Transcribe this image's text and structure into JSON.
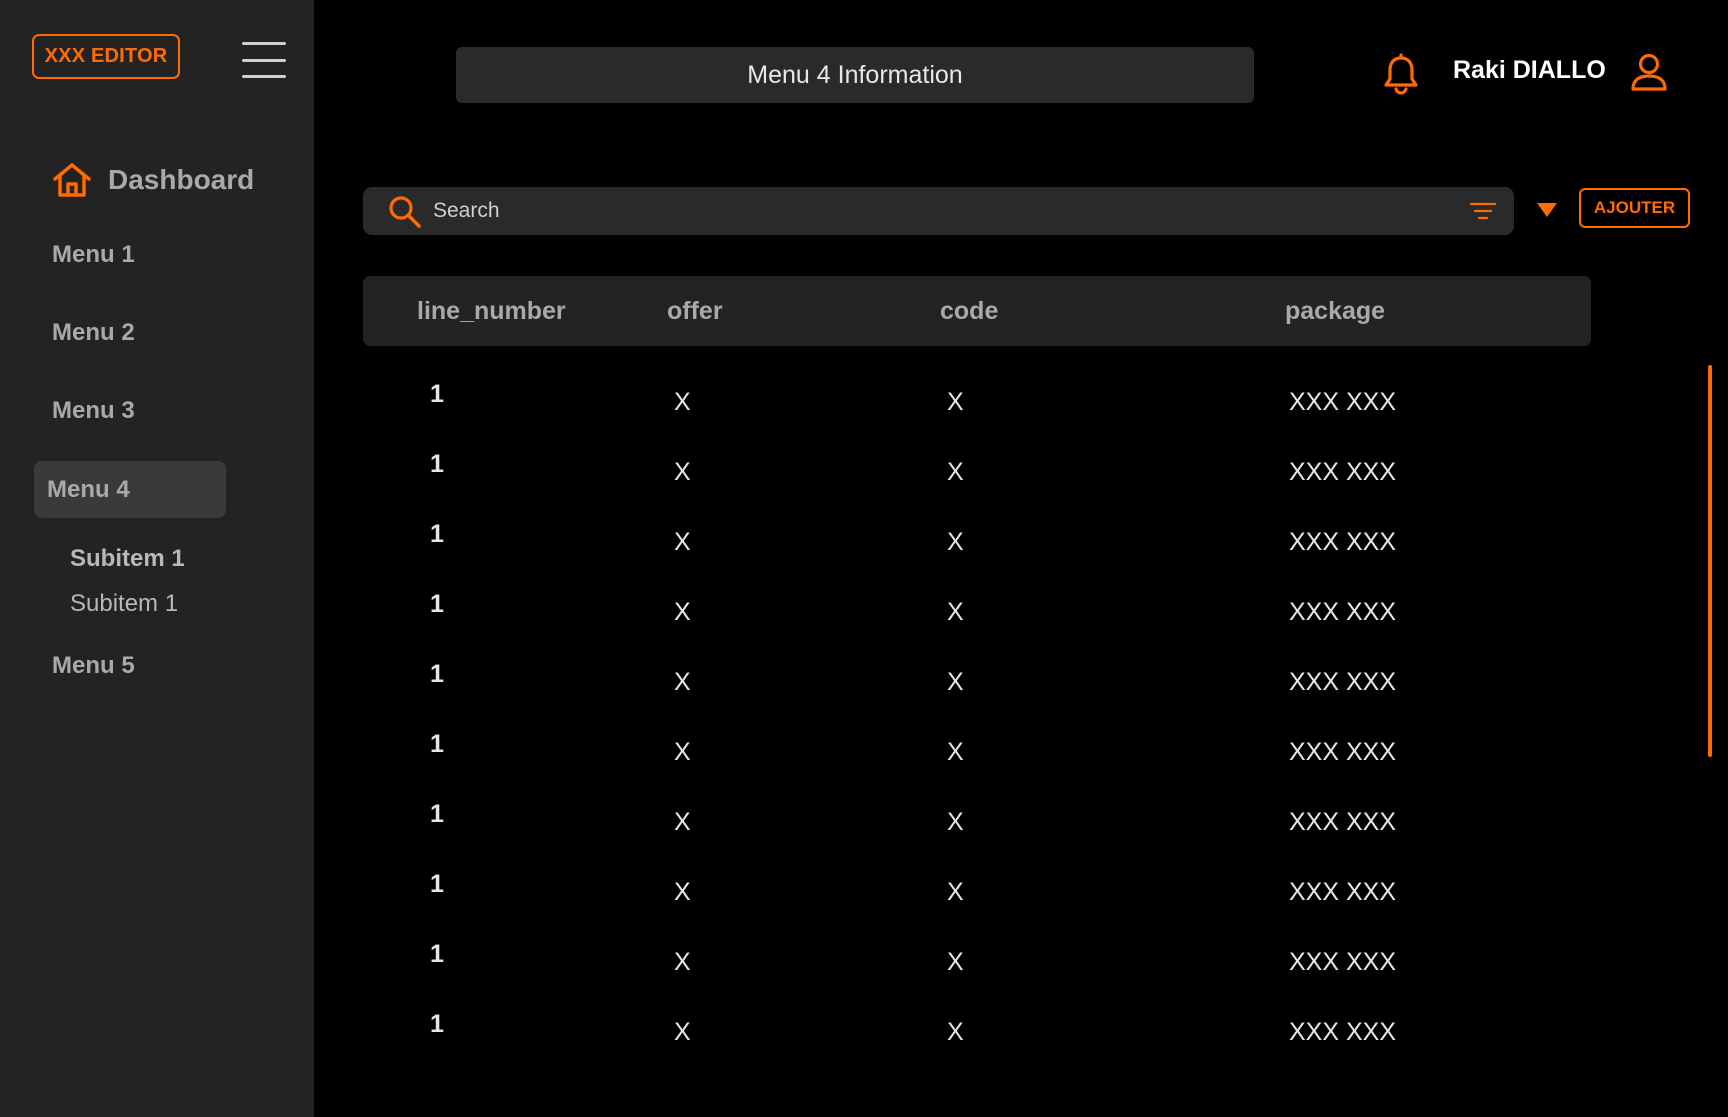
{
  "app": {
    "logo": "XXX EDITOR",
    "accent_color": "#ff6b00"
  },
  "sidebar": {
    "dashboard_label": "Dashboard",
    "menus": [
      "Menu 1",
      "Menu 2",
      "Menu 3",
      "Menu 4",
      "Menu 5"
    ],
    "active_menu": "Menu 4",
    "subitems": [
      "Subitem 1",
      "Subitem 1"
    ]
  },
  "header": {
    "title": "Menu 4 Information",
    "user_name": "Raki DIALLO"
  },
  "search": {
    "placeholder": "Search"
  },
  "toolbar": {
    "add_label": "AJOUTER"
  },
  "table": {
    "columns": [
      "line_number",
      "offer",
      "code",
      "package"
    ],
    "rows": [
      [
        "1",
        "X",
        "X",
        "XXX XXX"
      ],
      [
        "1",
        "X",
        "X",
        "XXX XXX"
      ],
      [
        "1",
        "X",
        "X",
        "XXX XXX"
      ],
      [
        "1",
        "X",
        "X",
        "XXX XXX"
      ],
      [
        "1",
        "X",
        "X",
        "XXX XXX"
      ],
      [
        "1",
        "X",
        "X",
        "XXX XXX"
      ],
      [
        "1",
        "X",
        "X",
        "XXX XXX"
      ],
      [
        "1",
        "X",
        "X",
        "XXX XXX"
      ],
      [
        "1",
        "X",
        "X",
        "XXX XXX"
      ],
      [
        "1",
        "X",
        "X",
        "XXX XXX"
      ]
    ]
  }
}
